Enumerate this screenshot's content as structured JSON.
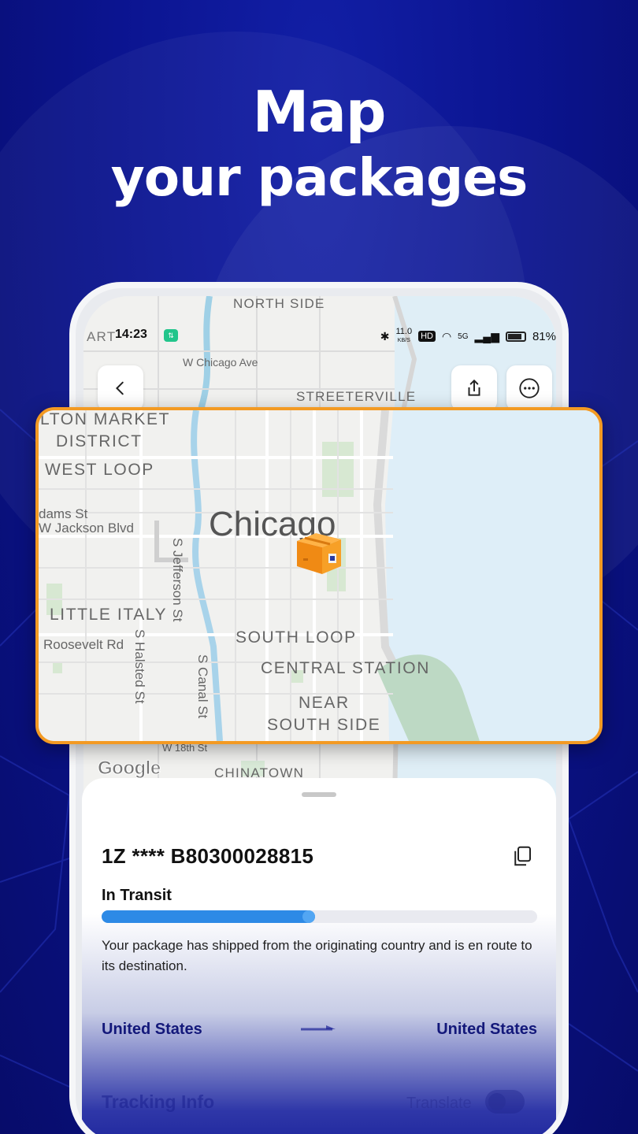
{
  "headline": {
    "line1": "Map",
    "line2": "your packages"
  },
  "status_bar": {
    "time": "14:23",
    "badge": "⇅",
    "speed": "11.0",
    "speed_unit": "KB/S",
    "hd": "HD",
    "network": "5G",
    "battery": "81%"
  },
  "map": {
    "labels": {
      "north_side": "NORTH SIDE",
      "w_chicago_ave": "W Chicago Ave",
      "streeterville": "STREETERVILLE",
      "chinatown": "CHINATOWN",
      "art": "ART",
      "w_18th": "W 18th St"
    },
    "attribution": "Google"
  },
  "zoom_map": {
    "labels": {
      "fulton_market": "LTON MARKET",
      "district": "DISTRICT",
      "west_loop": "WEST LOOP",
      "adams_st": "dams St",
      "w_jackson": "W Jackson Blvd",
      "city": "Chicago",
      "s_jefferson": "S Jefferson St",
      "little_italy": "LITTLE ITALY",
      "roosevelt": "Roosevelt Rd",
      "s_halsted": "S Halsted St",
      "s_canal": "S Canal St",
      "south_loop": "SOUTH LOOP",
      "central_station": "CENTRAL STATION",
      "near": "NEAR",
      "south_side": "SOUTH SIDE"
    },
    "accent_color": "#f39a23"
  },
  "sheet": {
    "tracking_number": "1Z **** B80300028815",
    "status": "In Transit",
    "progress": 0.49,
    "description": "Your package has shipped from the originating country and is en route to its destination.",
    "origin": "United States",
    "destination": "United States",
    "tracking_info_title": "Tracking Info",
    "translate_label": "Translate"
  },
  "colors": {
    "background": "#0b138c",
    "progress_fill": "#2d8ae6",
    "route_text": "#13187a"
  }
}
